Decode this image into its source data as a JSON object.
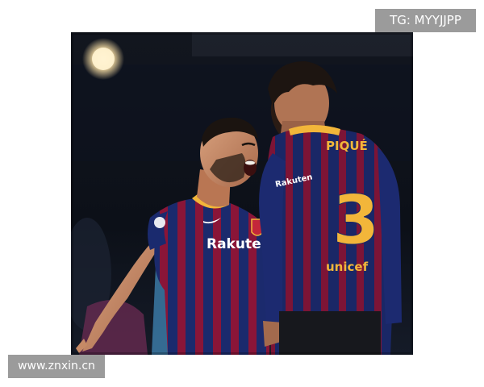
{
  "watermark_top": "TG: MYYJJPP",
  "watermark_bottom": "www.znxin.cn",
  "photo": {
    "sponsor_left": "Rakuten",
    "player_right_name": "PIQUÉ",
    "player_right_number": "3",
    "sponsor_right": "unicef",
    "sleeve_badge": "Rakuten",
    "colors": {
      "jersey_blue": "#1a2a6e",
      "jersey_claret": "#8a1538",
      "number_gold": "#f2b63a",
      "background": "#0b0f1a"
    }
  }
}
